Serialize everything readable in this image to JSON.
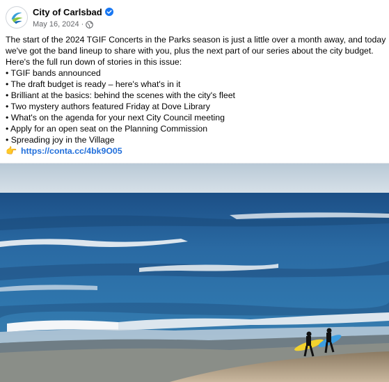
{
  "post": {
    "author": "City of Carlsbad",
    "verified_icon": "verified-badge-icon",
    "date": "May 16, 2024",
    "separator": "·",
    "audience_icon": "globe-icon",
    "intro_line1": "The start of the 2024 TGIF Concerts in the Parks season is just a little over a month away, and today",
    "intro_line2": "we've got the band lineup to share with you, plus the next part of our series about the city budget.",
    "intro_line3": "Here's the full run down of stories in this issue:",
    "bullets": [
      "• TGIF bands announced",
      "• The draft budget is ready – here's what's in it",
      "• Brilliant at the basics: behind the scenes with the city's fleet",
      "• Two mystery authors featured Friday at Dove Library",
      "• What's on the agenda for your next City Council meeting",
      "• Apply for an open seat on the Planning Commission",
      "• Spreading joy in the Village"
    ],
    "link_emoji": "👉",
    "link_text": "https://conta.cc/4bk9O05"
  },
  "photo": {
    "subject": "ocean-beach-surfers-photo"
  },
  "colors": {
    "link": "#216fdb",
    "verified": "#1877f2",
    "meta_text": "#65676b"
  }
}
